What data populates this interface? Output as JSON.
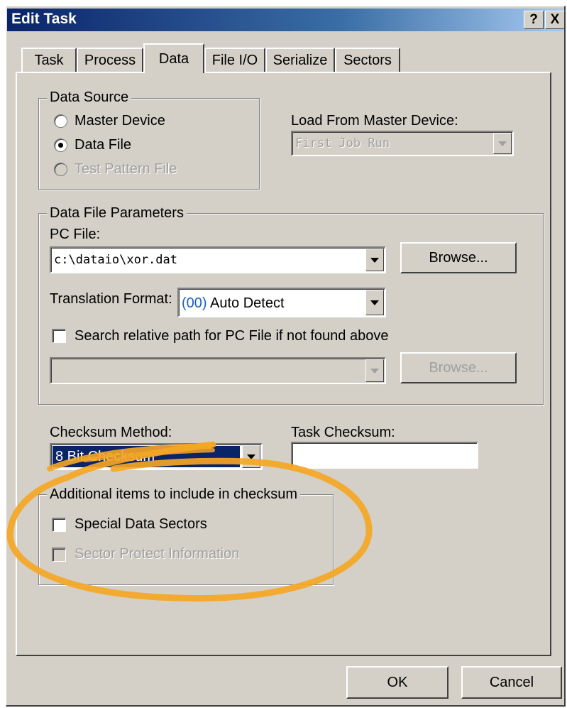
{
  "window": {
    "title": "Edit Task",
    "help_label": "?",
    "close_label": "X"
  },
  "tabs": [
    {
      "label": "Task"
    },
    {
      "label": "Process"
    },
    {
      "label": "Data"
    },
    {
      "label": "File I/O"
    },
    {
      "label": "Serialize"
    },
    {
      "label": "Sectors"
    }
  ],
  "active_tab": "Data",
  "data_source": {
    "legend": "Data Source",
    "options": [
      {
        "label": "Master Device",
        "selected": false,
        "enabled": true
      },
      {
        "label": "Data File",
        "selected": true,
        "enabled": true
      },
      {
        "label": "Test Pattern File",
        "selected": false,
        "enabled": false
      }
    ]
  },
  "load_from_master": {
    "label": "Load From Master Device:",
    "value": "First Job Run"
  },
  "data_file_params": {
    "legend": "Data File Parameters",
    "pc_file_label": "PC File:",
    "pc_file_value": "c:\\dataio\\xor.dat",
    "browse_label": "Browse...",
    "translation_label": "Translation Format:",
    "translation_code": "(00)",
    "translation_value": " Auto Detect",
    "search_relative_label": "Search relative path for PC File if not found above",
    "search_relative_checked": false,
    "relative_path_value": "",
    "browse2_label": "Browse..."
  },
  "checksum": {
    "method_label": "Checksum Method:",
    "method_value": "8 Bit Checksum",
    "task_checksum_label": "Task Checksum:",
    "task_checksum_value": ""
  },
  "additional": {
    "legend": "Additional items to include in checksum",
    "special_data_sectors_label": "Special Data Sectors",
    "sector_protect_label": "Sector Protect Information"
  },
  "footer": {
    "ok_label": "OK",
    "cancel_label": "Cancel"
  },
  "colors": {
    "dialog_bg": "#d4d0c8",
    "title_bar": "#0a246a",
    "selection": "#0a246a",
    "highlight_annotation": "#f5a623",
    "code_blue": "#1a5fc8",
    "disabled_text": "#a0a0a0"
  }
}
